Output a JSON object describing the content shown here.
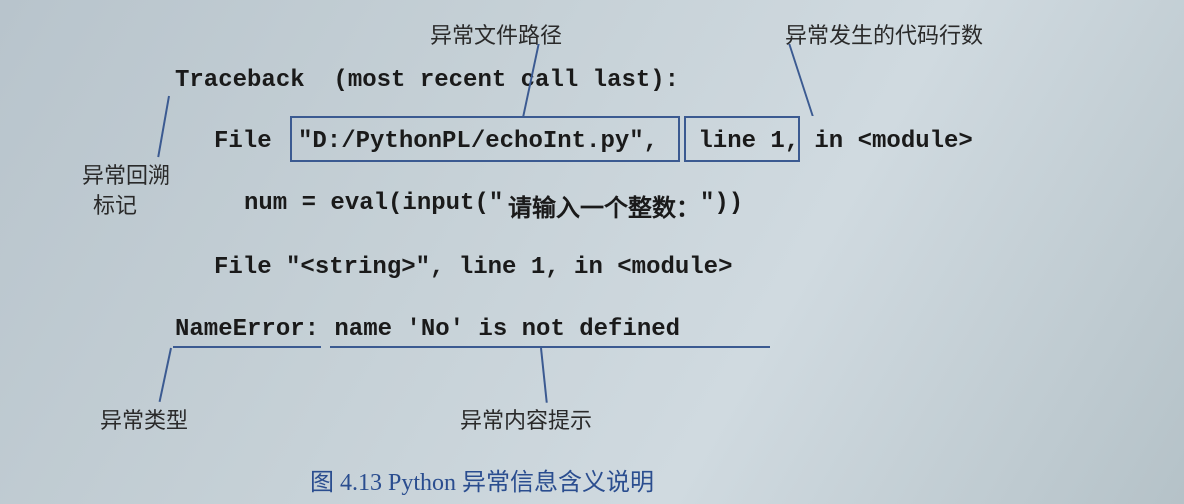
{
  "annotations": {
    "file_path": "异常文件路径",
    "line_number": "异常发生的代码行数",
    "traceback_marker_l1": "异常回溯",
    "traceback_marker_l2": "标记",
    "error_type": "异常类型",
    "error_message": "异常内容提示"
  },
  "code": {
    "traceback_header": "Traceback  (most recent call last):",
    "file_prefix": "File ",
    "file_path_quoted": "\"D:/PythonPL/echoInt.py\",",
    "line_no": " line 1,",
    "module_suffix": " in <module>",
    "eval_line_prefix": "num = eval(input(\"",
    "eval_line_cjk": "请输入一个整数：",
    "eval_line_suffix": "\"))",
    "file2": "File \"<string>\", line 1, in <module>",
    "error_type": "NameError:",
    "error_msg": " name 'No' is not defined"
  },
  "caption": "图 4.13   Python 异常信息含义说明"
}
